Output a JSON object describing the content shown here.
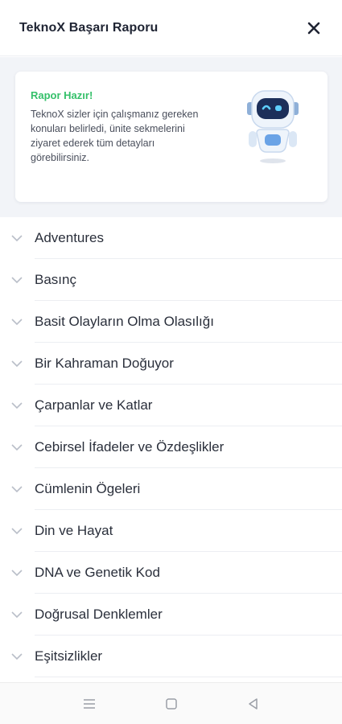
{
  "header": {
    "title": "TeknoX Başarı Raporu",
    "close_icon": "close-icon"
  },
  "report": {
    "heading": "Rapor Hazır!",
    "body": "TeknoX sizler için çalışmanız gereken konuları belirledi, ünite sekmelerini ziyaret ederek tüm detayları görebilirsiniz.",
    "mascot_icon": "robot-icon",
    "accent_color": "#35c06a"
  },
  "topics": [
    {
      "label": "Adventures"
    },
    {
      "label": "Basınç"
    },
    {
      "label": "Basit Olayların Olma Olasılığı"
    },
    {
      "label": "Bir Kahraman Doğuyor"
    },
    {
      "label": "Çarpanlar ve Katlar"
    },
    {
      "label": "Cebirsel İfadeler ve Özdeşlikler"
    },
    {
      "label": "Cümlenin Ögeleri"
    },
    {
      "label": "Din ve Hayat"
    },
    {
      "label": "DNA ve Genetik Kod"
    },
    {
      "label": "Doğrusal Denklemler"
    },
    {
      "label": "Eşitsizlikler"
    }
  ],
  "navbar": {
    "icons": [
      "menu-icon",
      "home-square-icon",
      "back-triangle-icon"
    ]
  }
}
